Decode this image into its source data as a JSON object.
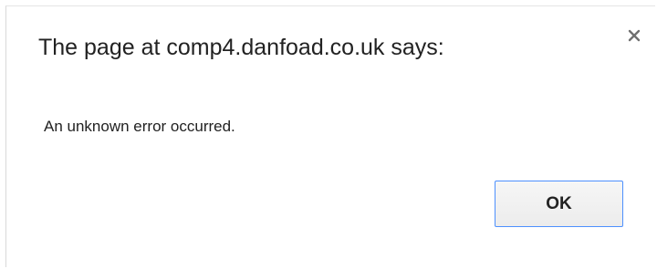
{
  "dialog": {
    "title": "The page at comp4.danfoad.co.uk says:",
    "message": "An unknown error occurred.",
    "close_icon": "close-icon",
    "ok_label": "OK"
  }
}
